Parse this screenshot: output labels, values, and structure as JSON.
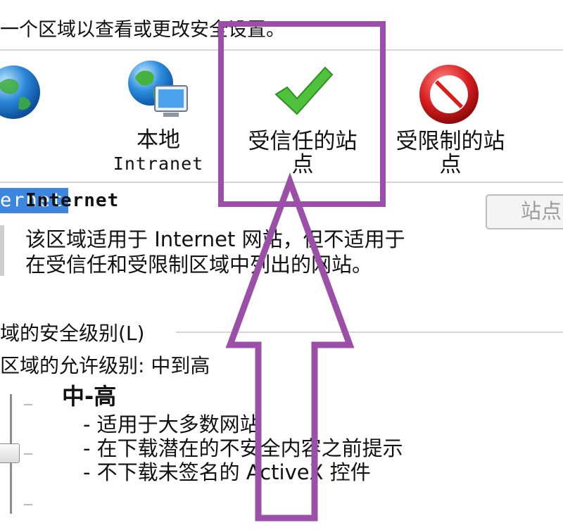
{
  "header": {
    "instruction": "一个区域以查看或更改安全设置。"
  },
  "zones": [
    {
      "id": "internet",
      "label": "ernet",
      "icon": "globe-icon",
      "selected": true
    },
    {
      "id": "local-intranet",
      "label": "本地",
      "sublabel": "Intranet",
      "icon": "globe-computer-icon"
    },
    {
      "id": "trusted-sites",
      "label_line1": "受信任的站",
      "label_line2": "点",
      "icon": "checkmark-icon"
    },
    {
      "id": "restricted-sites",
      "label_line1": "受限制的站",
      "label_line2": "点",
      "icon": "no-entry-icon"
    }
  ],
  "zone_info": {
    "name": "Internet",
    "sites_button": "站点",
    "description_line1": "该区域适用于 Internet 网站，但不适用于",
    "description_line2": "在受信任和受限制区域中列出的网站。"
  },
  "security": {
    "group_label": "域的安全级别(L)",
    "allowed_levels": "区域的允许级别: 中到高",
    "level_title": "中-高",
    "bullets": [
      "- 适用于大多数网站",
      "- 在下载潜在的不安全内容之前提示",
      "- 不下载未签名的 ActiveX 控件"
    ]
  },
  "annotation": {
    "color": "#9b4fa8"
  },
  "colors": {
    "selection": "#3d86e0",
    "check": "#4fc13a",
    "restricted": "#d91e1e"
  }
}
